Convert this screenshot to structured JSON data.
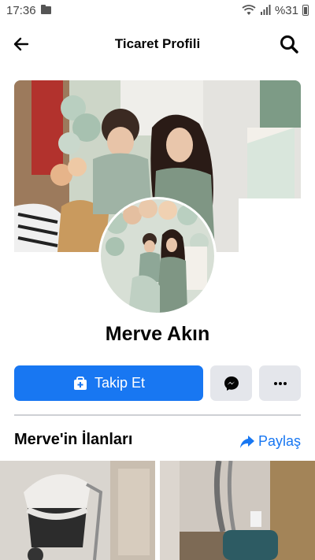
{
  "status_bar": {
    "time": "17:36",
    "battery": "%31"
  },
  "header": {
    "title": "Ticaret Profili"
  },
  "profile": {
    "name": "Merve Akın"
  },
  "actions": {
    "follow_label": "Takip Et"
  },
  "listings": {
    "title": "Merve'in İlanları",
    "share_label": "Paylaş"
  },
  "colors": {
    "accent": "#1877f2",
    "secondary_button": "#e4e6eb",
    "divider": "#ced0d4"
  }
}
